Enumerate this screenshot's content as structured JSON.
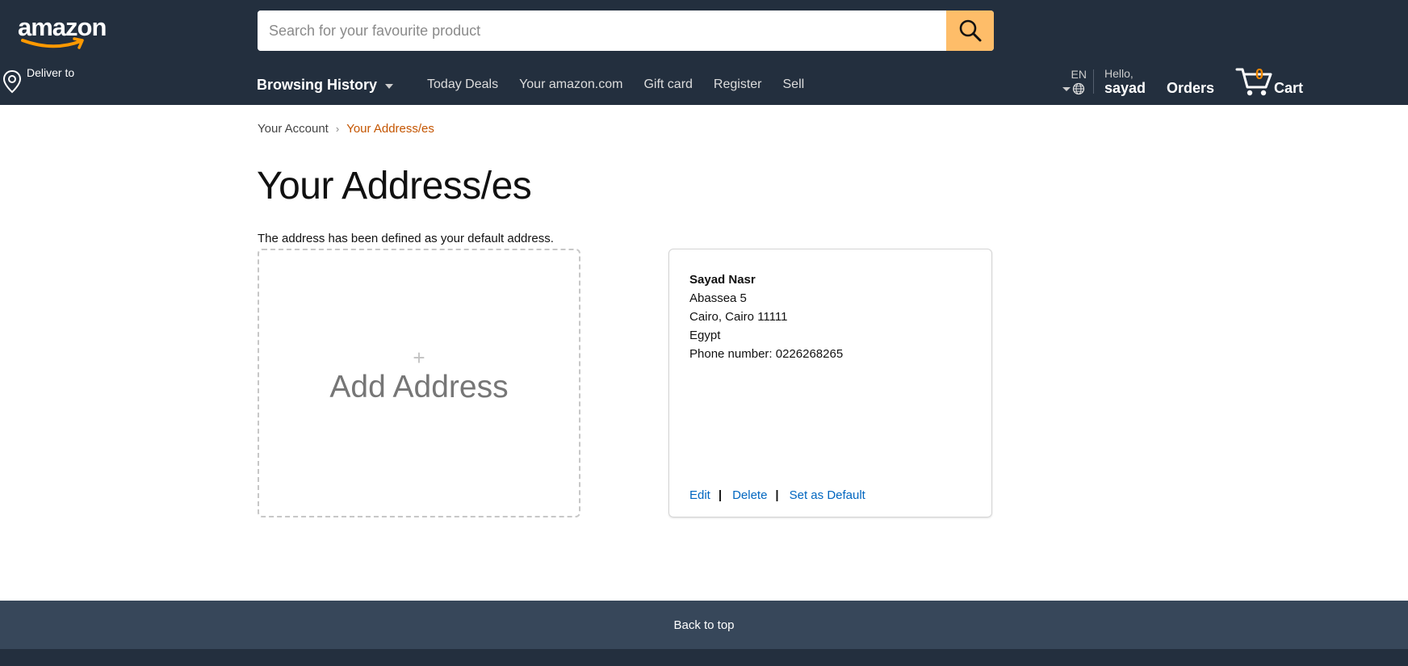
{
  "header": {
    "logo_text": "amazon",
    "deliver_label": "Deliver to",
    "search": {
      "placeholder": "Search for your favourite product"
    },
    "nav": {
      "browsing_history": "Browsing History",
      "links": [
        "Today Deals",
        "Your amazon.com",
        "Gift card",
        "Register",
        "Sell"
      ]
    },
    "language": "EN",
    "greeting": "Hello,",
    "username": "sayad",
    "orders": "Orders",
    "cart": {
      "count": "0",
      "label": "Cart"
    }
  },
  "breadcrumb": {
    "account": "Your Account",
    "separator": "›",
    "current": "Your Address/es"
  },
  "page": {
    "title": "Your Address/es",
    "message": "The address has been defined as your default address."
  },
  "add_address": {
    "plus": "+",
    "label": "Add Address"
  },
  "address_card": {
    "name": "Sayad Nasr",
    "street": "Abassea 5",
    "city_line": "Cairo, Cairo 11111",
    "country": "Egypt",
    "phone": "Phone number: 0226268265",
    "actions": {
      "edit": "Edit",
      "delete": "Delete",
      "set_default": "Set as Default",
      "separator": "|"
    }
  },
  "footer": {
    "back_to_top": "Back to top"
  },
  "colors": {
    "header_bg": "#232f3e",
    "search_button": "#febd69",
    "link_blue": "#0066c0",
    "breadcrumb_active": "#c45500",
    "cart_count": "#f08804",
    "back_to_top_bg": "#37475a"
  }
}
